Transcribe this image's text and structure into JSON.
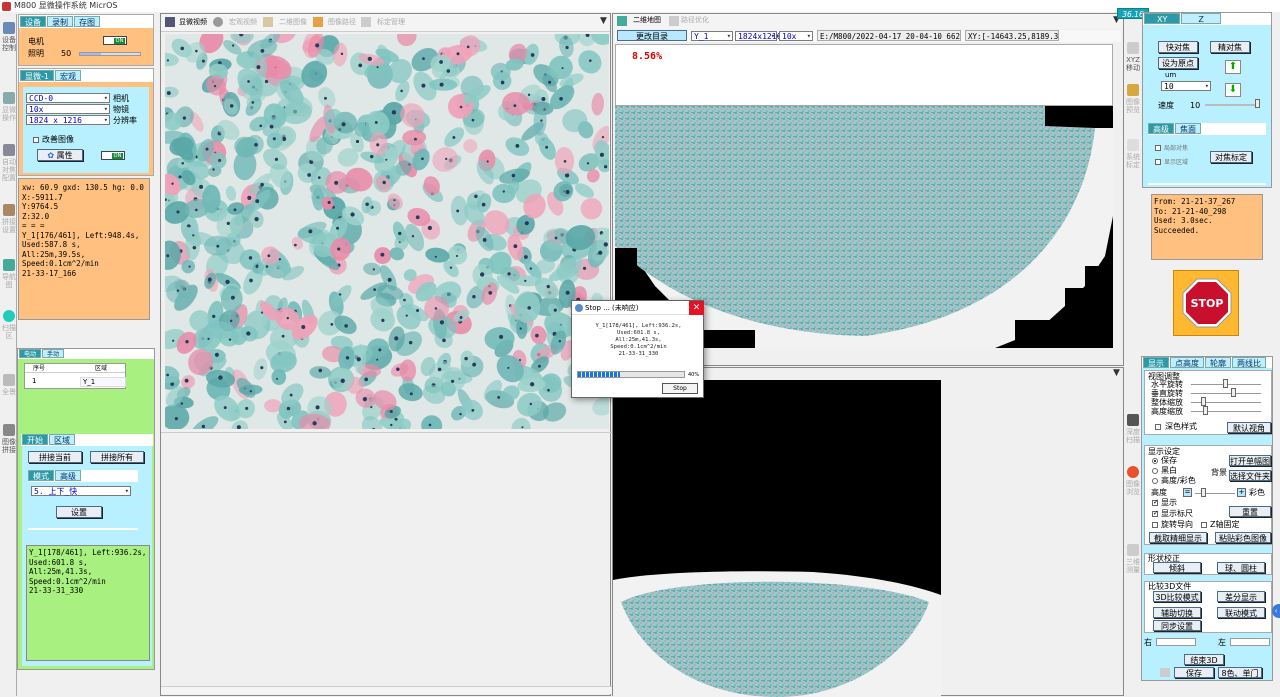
{
  "app": {
    "title": "M800 显微操作系统 MicrOS",
    "fps": "36.16"
  },
  "left_rail": {
    "items": [
      "设备控制",
      "显微操作",
      "自动对焦配置",
      "拼接设置",
      "导航图",
      "扫描区",
      "全景",
      "图像拼接"
    ]
  },
  "device_panel": {
    "tabs": [
      "设备",
      "录制",
      "存图"
    ],
    "motor_label": "电机",
    "motor_toggle": "ON",
    "light_label": "照明",
    "light_value": "50",
    "light_fraction": 0.35
  },
  "microscope_panel": {
    "tabs": [
      "显微-1",
      "宏观"
    ],
    "camera": {
      "value": "CCD-0",
      "label": "相机"
    },
    "objective": {
      "value": "10x",
      "label": "物镜"
    },
    "resolution": {
      "value": "1824 x 1216",
      "label": "分辨率"
    },
    "improve_label": "改善图像",
    "property_btn": "属性",
    "toggle": "ON"
  },
  "status_panel": {
    "lines": [
      "xw: 60.9 gxd: 130.5 hg: 0.0",
      "X:-5911.7",
      "Y:9764.5",
      "Z:32.0",
      "= = =",
      "Y_1[176/461], Left:948.4s,",
      "Used:587.8 s,",
      "All:25m,39.5s,",
      "Speed:0.1cm^2/min",
      "21-33-17_166"
    ]
  },
  "area_panel": {
    "tabs": [
      "电动",
      "手动"
    ],
    "table": {
      "headers": [
        "序号",
        "区域"
      ],
      "rows": [
        [
          "1",
          "Y_1"
        ]
      ]
    },
    "sub_tabs": [
      "开始",
      "区域"
    ],
    "stitch_current": "拼接当前",
    "stitch_all": "拼接所有",
    "mode_tabs": [
      "模式",
      "高级"
    ],
    "mode_value": "5. 上下_快",
    "settings_btn": "设置",
    "log": [
      "Y_1[178/461], Left:936.2s,",
      "Used:601.8 s,",
      "All:25m,41.3s,",
      "Speed:0.1cm^2/min",
      "21-33-31_330"
    ]
  },
  "view_tabs": {
    "main": [
      "显微视频",
      "宏观视频",
      "二维图像",
      "图像路径",
      "标定管理"
    ],
    "nav": [
      "二维地图",
      "路径优化"
    ]
  },
  "nav_toolbar": {
    "change_dir": "更改目录",
    "area": "Y_1",
    "resolution": "1824x121€",
    "objective": "10x",
    "path": "E:/M800/2022-04-17_20-04-10_662",
    "xy": "XY:[-14643.25,8189.39]"
  },
  "progress_label": "8.56%",
  "dialog": {
    "title": "Stop ... (未响应)",
    "lines": [
      "Y_1[178/461], Left:936.2s,",
      "Used:601.8 s,",
      "All:25m,41.3s,",
      "Speed:0.1cm^2/min",
      "21-33-31_330"
    ],
    "progress": 0.4,
    "progress_text": "40%",
    "stop_btn": "Stop"
  },
  "right_rail": {
    "items": [
      "XYZ移动",
      "图像预览",
      "系统标定",
      "深度扫描",
      "图像浏览",
      "三维测量"
    ]
  },
  "focus_panel": {
    "tabs": [
      "XY",
      "Z"
    ],
    "fast_focus": "快对焦",
    "fine_focus": "精对焦",
    "set_origin": "设为原点",
    "unit": "um",
    "step_value": "10",
    "speed_label": "速度",
    "speed_value": "10",
    "sub_tabs": [
      "高级",
      "焦面"
    ],
    "local_focus": "局部对焦",
    "show_area": "显示区域",
    "focus_calib": "对焦标定"
  },
  "focus_log": [
    "From: 21-21-37_267",
    "To: 21-21-40_298",
    "Used: 3.0sec.",
    "Succeeded."
  ],
  "stop_button": {
    "label": "STOP",
    "color": "#c8102e"
  },
  "display_panel": {
    "tabs": [
      "显示",
      "点高度",
      "轮廓",
      "两线比"
    ],
    "view_adjust": "视图调整",
    "h_rotate": "水平旋转",
    "v_rotate": "垂直旋转",
    "zoom_all": "整体缩放",
    "zoom_height": "高度缩放",
    "dark_mode": "深色样式",
    "default_view": "默认视角",
    "display_settings": "显示设定",
    "opt_save": "保存",
    "opt_bw": "黑白",
    "opt_height_color": "高度/彩色",
    "bg_label": "背景",
    "open_single": "打开单幅图",
    "select_folder": "选择文件夹",
    "height_label": "高度",
    "color_label": "彩色",
    "show_label": "显示",
    "show_ruler": "显示标尺",
    "reset": "重置",
    "rotate_guide": "旋转导向",
    "z_fixed": "Z轴固定",
    "capture_fine": "截取精细显示",
    "paste_color": "粘贴彩色图像",
    "shape_correction": "形状校正",
    "tilt": "倾斜",
    "sphere": "球、圆柱",
    "compare_3d": "比较3D文件",
    "mode_3d": "3D比较模式",
    "diff_show": "差分显示",
    "aux_switch": "辅助切换",
    "link_mode": "联动模式",
    "sync_settings": "同步设置",
    "right_label": "右",
    "left_label": "左",
    "end_3d": "结束3D",
    "save": "保存",
    "color_single": "8色、单门"
  }
}
